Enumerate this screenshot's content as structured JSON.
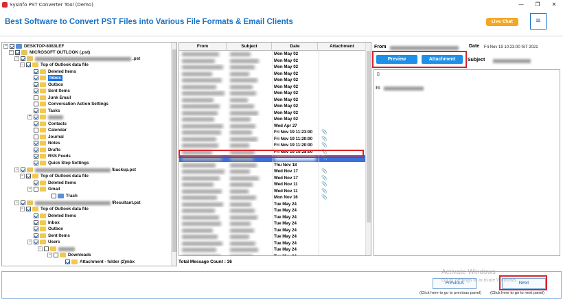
{
  "window": {
    "title": "Sysinfo PST Converter Tool (Demo)",
    "controls": [
      "—",
      "❐",
      "✕"
    ]
  },
  "banner": {
    "headline": "Best Software to Convert PST Files into Various File Formats & Email Clients",
    "live_chat": "Live Chat",
    "menu_icon": "≡"
  },
  "tree": {
    "computer": "DESKTOP-8083LEF",
    "root": "MICROSOFT OUTLOOK (.pst)",
    "pst1_suffix": ".pst",
    "top1": "Top of Outlook data file",
    "f_deleted": "Deleted Items",
    "f_inbox": "Inbox",
    "f_outbox": "Outbox",
    "f_sent": "Sent Items",
    "f_junk": "Junk Email",
    "f_conv": "Conversation Action Settings",
    "f_tasks": "Tasks",
    "f_contacts": "Contacts",
    "f_calendar": "Calendar",
    "f_journal": "Journal",
    "f_notes": "Notes",
    "f_drafts": "Drafts",
    "f_rss": "RSS Feeds",
    "f_quick": "Quick Step Settings",
    "pst2_suffix": "\\backup.pst",
    "top2": "Top of Outlook data file",
    "f2_deleted": "Deleted Items",
    "f2_gmail": "Gmail",
    "f2_trash": "Trash",
    "pst3_suffix": "\\Resultant.pst",
    "top3": "Top of Outlook data file",
    "f3_deleted": "Deleted Items",
    "f3_inbox": "Inbox",
    "f3_outbox": "Outbox",
    "f3_sent": "Sent Items",
    "f3_users": "Users",
    "f3_downloads": "Downloads",
    "f3_attach": "Attachment - folder (2)mbx"
  },
  "grid": {
    "headers": {
      "from": "From",
      "subject": "Subject",
      "date": "Date",
      "attachment": "Attachment"
    },
    "rows": [
      {
        "date": "Mon May 02",
        "att": ""
      },
      {
        "date": "Mon May 02",
        "att": ""
      },
      {
        "date": "Mon May 02",
        "att": ""
      },
      {
        "date": "Mon May 02",
        "att": ""
      },
      {
        "date": "Mon May 02",
        "att": ""
      },
      {
        "date": "Mon May 02",
        "att": ""
      },
      {
        "date": "Mon May 02",
        "att": ""
      },
      {
        "date": "Mon May 02",
        "att": ""
      },
      {
        "date": "Mon May 02",
        "att": ""
      },
      {
        "date": "Mon May 02",
        "att": ""
      },
      {
        "date": "Mon May 02",
        "att": ""
      },
      {
        "date": "Wed Apr 27",
        "att": ""
      },
      {
        "date": "Fri Nov 19 11:23:00",
        "att": "📎"
      },
      {
        "date": "Fri Nov 19 11:20:00",
        "att": "📎"
      },
      {
        "date": "Fri Nov 19 11:20:00",
        "att": "📎"
      },
      {
        "date": "Fri Nov 19 10:28:00",
        "att": "📎"
      },
      {
        "date": "",
        "att": "📎"
      },
      {
        "date": "Thu Nov 18",
        "att": ""
      },
      {
        "date": "Wed Nov 17",
        "att": "📎"
      },
      {
        "date": "Wed Nov 17",
        "att": "📎"
      },
      {
        "date": "Wed Nov 11",
        "att": "📎"
      },
      {
        "date": "Wed Nov 11",
        "att": "📎"
      },
      {
        "date": "Mon Nov 16",
        "att": "📎"
      },
      {
        "date": "Tue May 24",
        "att": ""
      },
      {
        "date": "Tue May 24",
        "att": ""
      },
      {
        "date": "Tue May 24",
        "att": ""
      },
      {
        "date": "Tue May 24",
        "att": ""
      },
      {
        "date": "Tue May 24",
        "att": ""
      },
      {
        "date": "Tue May 24",
        "att": ""
      },
      {
        "date": "Tue May 24",
        "att": ""
      },
      {
        "date": "Tue May 24",
        "att": ""
      },
      {
        "date": "Tue May 24",
        "att": ""
      }
    ],
    "total_label": "Total Message Count : 36"
  },
  "preview": {
    "from_label": "From",
    "date_label": "Date",
    "date_value": "Fri Nov 19 10:23:00 IST 2021",
    "subject_label": "Subject",
    "preview_btn": "Preview",
    "attachment_btn": "Attachment",
    "body_glyph": "▯",
    "body_hi": "Hi"
  },
  "footer": {
    "previous_btn": "Previous",
    "previous_hint": "(Click here to go to previous panel)",
    "next_btn": "Next",
    "next_hint": "(Click here to go to next panel)",
    "activate_title": "Activate Windows",
    "activate_sub": "Go to Settings to activate Windows."
  },
  "colors": {
    "accent": "#1a73c8",
    "live_chat": "#f5a623",
    "highlight_box": "#d8232a",
    "selection": "#3e6fd8"
  }
}
